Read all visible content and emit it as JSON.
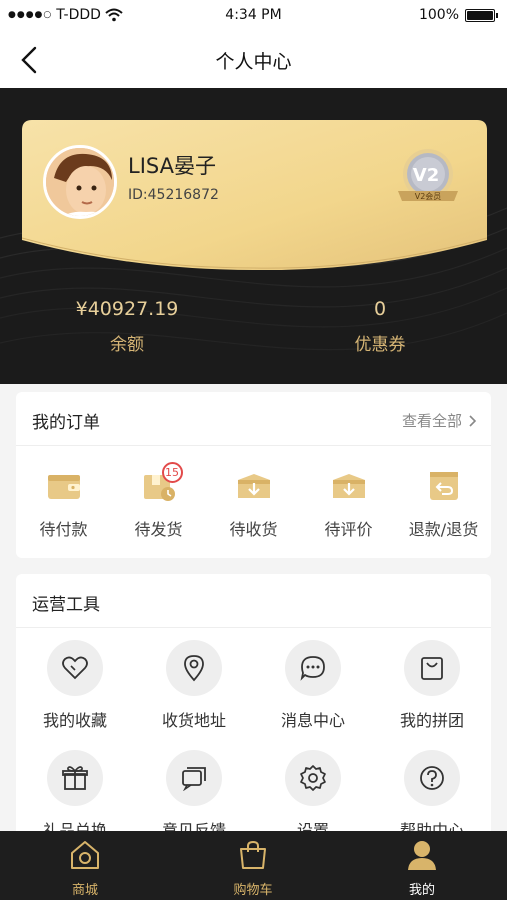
{
  "status_bar": {
    "carrier": "T-DDD",
    "time": "4:34 PM",
    "battery": "100%"
  },
  "nav": {
    "title": "个人中心",
    "back_icon": "chevron-left-icon"
  },
  "profile": {
    "name": "LISA晏子",
    "id_text": "ID:45216872",
    "level_badge": "V2",
    "level_label": "V2会员",
    "balance_value": "¥40927.19",
    "balance_label": "余额",
    "coupon_value": "0",
    "coupon_label": "优惠券"
  },
  "orders": {
    "title": "我的订单",
    "view_all": "查看全部",
    "items": [
      {
        "label": "待付款",
        "icon": "wallet-icon"
      },
      {
        "label": "待发货",
        "icon": "package-clock-icon",
        "badge": "15"
      },
      {
        "label": "待收货",
        "icon": "box-download-icon"
      },
      {
        "label": "待评价",
        "icon": "box-download-icon"
      },
      {
        "label": "退款/退货",
        "icon": "return-icon"
      }
    ]
  },
  "tools": {
    "title": "运营工具",
    "items": [
      {
        "label": "我的收藏",
        "icon": "heart-icon"
      },
      {
        "label": "收货地址",
        "icon": "location-pin-icon"
      },
      {
        "label": "消息中心",
        "icon": "message-icon"
      },
      {
        "label": "我的拼团",
        "icon": "shopping-bag-icon"
      },
      {
        "label": "礼品兑换",
        "icon": "gift-icon"
      },
      {
        "label": "意见反馈",
        "icon": "feedback-icon"
      },
      {
        "label": "设置",
        "icon": "gear-icon"
      },
      {
        "label": "帮助中心",
        "icon": "help-icon"
      }
    ]
  },
  "tabbar": {
    "items": [
      {
        "label": "商城",
        "icon": "home-icon",
        "active": false
      },
      {
        "label": "购物车",
        "icon": "cart-bag-icon",
        "active": false
      },
      {
        "label": "我的",
        "icon": "user-icon",
        "active": true
      }
    ]
  },
  "colors": {
    "gold": "#d6b575",
    "dark": "#1b1b1b",
    "card_gold": "#f5d98f"
  }
}
